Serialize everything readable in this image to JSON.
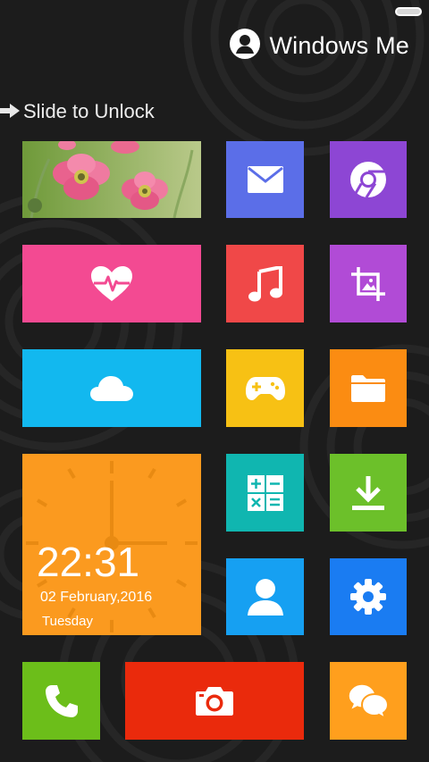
{
  "status": {
    "battery_icon": "battery-icon"
  },
  "user": {
    "name": "Windows Me",
    "icon": "user-avatar-icon"
  },
  "unlock": {
    "label": "Slide to Unlock",
    "icon": "arrow-right-icon"
  },
  "clock": {
    "time": "22:31",
    "date": "02 February,2016",
    "day": "Tuesday"
  },
  "colors": {
    "background": "#1c1c1c",
    "mail": "#5b6ee8",
    "chrome": "#8d46d4",
    "health": "#f34a92",
    "music": "#f04848",
    "crop": "#b14bd6",
    "weather": "#12b8ef",
    "games": "#f7c114",
    "files": "#fb8c12",
    "clock": "#fb9a1f",
    "calculator": "#10b6b0",
    "download": "#6cc02a",
    "contacts": "#16a0f2",
    "settings": "#1a7cf2",
    "phone": "#6cbe1a",
    "camera": "#ea2a0c",
    "messages": "#ff9f1d"
  },
  "tiles": [
    {
      "id": "photos",
      "icon": "flower-photo"
    },
    {
      "id": "mail",
      "icon": "mail-icon"
    },
    {
      "id": "chrome",
      "icon": "chrome-icon"
    },
    {
      "id": "health",
      "icon": "heart-pulse-icon"
    },
    {
      "id": "music",
      "icon": "music-note-icon"
    },
    {
      "id": "crop",
      "icon": "crop-icon"
    },
    {
      "id": "weather",
      "icon": "cloud-icon"
    },
    {
      "id": "games",
      "icon": "gamepad-icon"
    },
    {
      "id": "files",
      "icon": "folder-icon"
    },
    {
      "id": "clock",
      "icon": "analog-clock"
    },
    {
      "id": "calculator",
      "icon": "calculator-icon"
    },
    {
      "id": "download",
      "icon": "download-icon"
    },
    {
      "id": "contacts",
      "icon": "contact-icon"
    },
    {
      "id": "settings",
      "icon": "gear-icon"
    },
    {
      "id": "phone",
      "icon": "phone-icon"
    },
    {
      "id": "camera",
      "icon": "camera-icon"
    },
    {
      "id": "messages",
      "icon": "chat-icon"
    }
  ]
}
